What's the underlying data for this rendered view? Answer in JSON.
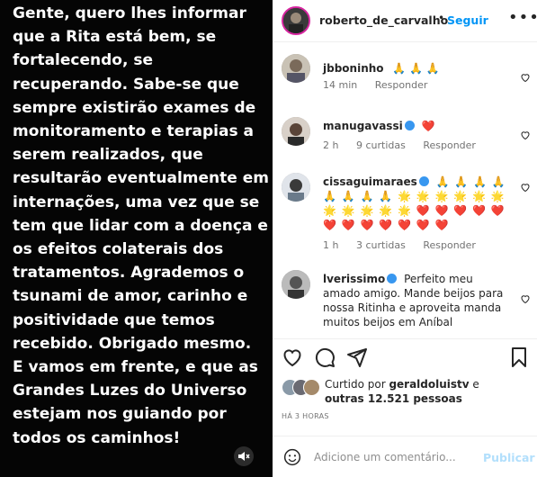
{
  "media": {
    "paragraph1": "Gente, quero lhes informar que a Rita está bem, se fortalecendo, se recuperando. Sabe-se que sempre existirão exames de monitoramento e terapias a serem realizados, que resultarão eventualmente em internações, uma vez que se tem que lidar com a doença e os efeitos colaterais dos tratamentos. Agrademos o tsunami de amor, carinho e positividade que temos recebido. Obrigado mesmo.",
    "paragraph2": "E vamos em frente, e que as Grandes Luzes do Universo estejam nos guiando por todos os caminhos!",
    "mute_icon": "speaker-muted-icon"
  },
  "header": {
    "username": "roberto_de_carvalho",
    "separator": "•",
    "follow_label": "Seguir",
    "more_label": "•••"
  },
  "comments": [
    {
      "username": "jbboninho",
      "text": "🙏 🙏 🙏",
      "time": "14 min",
      "likes": "",
      "reply": "Responder",
      "verified": false
    },
    {
      "username": "manugavassi",
      "text": "❤️",
      "time": "2 h",
      "likes": "9 curtidas",
      "reply": "Responder",
      "verified": true
    },
    {
      "username": "cissaguimaraes",
      "text": "🙏 🙏 🙏 🙏 🙏 🙏 🙏 🙏 🌟 🌟 🌟 🌟 🌟 🌟 🌟 🌟 🌟 🌟 🌟 ❤️ ❤️ ❤️ ❤️ ❤️ ❤️ ❤️ ❤️ ❤️ ❤️ ❤️ ❤️",
      "time": "1 h",
      "likes": "3 curtidas",
      "reply": "Responder",
      "verified": true
    },
    {
      "username": "lverissimo",
      "text": "Perfeito meu amado amigo. Mande beijos para nossa Ritinha e aproveita manda muitos beijos em Aníbal",
      "time": "",
      "likes": "",
      "reply": "",
      "verified": true
    }
  ],
  "actions": {
    "like_icon": "heart-icon",
    "comment_icon": "comment-icon",
    "share_icon": "paper-plane-icon",
    "save_icon": "bookmark-icon"
  },
  "likes": {
    "prefix": "Curtido por ",
    "user": "geraldoluistv",
    "middle": " e",
    "others": "outras 12.521 pessoas"
  },
  "timestamp": "HÁ 3 HORAS",
  "add_comment": {
    "placeholder": "Adicione um comentário...",
    "post_label": "Publicar",
    "emoji_icon": "smiley-icon"
  },
  "colors": {
    "accent": "#0095f6",
    "post_disabled": "#b2dffc",
    "heart_red": "#ed4956",
    "muted_text": "#737373"
  }
}
